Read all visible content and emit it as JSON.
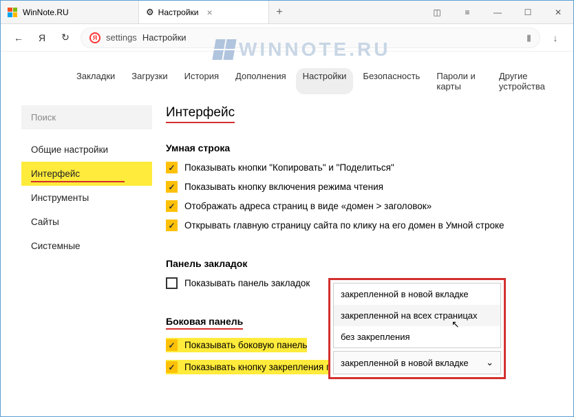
{
  "window": {
    "tab1_title": "WinNote.RU",
    "tab2_title": "Настройки"
  },
  "toolbar": {
    "back_glyph": "←",
    "yandex_glyph": "Я",
    "reload_glyph": "↻",
    "y_logo_text": "Я",
    "addr_path": "settings",
    "addr_title": "Настройки",
    "bookmark_glyph": "▮",
    "download_glyph": "↓",
    "newtab_glyph": "+",
    "close_glyph": "×",
    "reader_glyph": "◫",
    "menu_glyph": "≡",
    "min_glyph": "—",
    "max_glyph": "☐",
    "x_glyph": "✕"
  },
  "watermark": "WINNOTE.RU",
  "topnav": {
    "items": [
      {
        "label": "Закладки"
      },
      {
        "label": "Загрузки"
      },
      {
        "label": "История"
      },
      {
        "label": "Дополнения"
      },
      {
        "label": "Настройки"
      },
      {
        "label": "Безопасность"
      },
      {
        "label": "Пароли и карты"
      },
      {
        "label": "Другие устройства"
      }
    ]
  },
  "sidebar": {
    "search_placeholder": "Поиск",
    "items": [
      {
        "label": "Общие настройки"
      },
      {
        "label": "Интерфейс"
      },
      {
        "label": "Инструменты"
      },
      {
        "label": "Сайты"
      },
      {
        "label": "Системные"
      }
    ]
  },
  "main": {
    "heading": "Интерфейс",
    "smart_bar": {
      "title": "Умная строка",
      "opts": [
        "Показывать кнопки \"Копировать\" и \"Поделиться\"",
        "Показывать кнопку включения режима чтения",
        "Отображать адреса страниц в виде «домен > заголовок»",
        "Открывать главную страницу сайта по клику на его домен в Умной строке"
      ]
    },
    "bookmarks_panel": {
      "title": "Панель закладок",
      "opt": "Показывать панель закладок"
    },
    "side_panel": {
      "title": "Боковая панель",
      "opts": [
        "Показывать боковую панель",
        "Показывать кнопку закрепления панели"
      ]
    }
  },
  "dropdown": {
    "options": [
      "закрепленной в новой вкладке",
      "закрепленной на всех страницах",
      "без закрепления"
    ],
    "selected": "закрепленной в новой вкладке",
    "chevron": "⌄"
  }
}
